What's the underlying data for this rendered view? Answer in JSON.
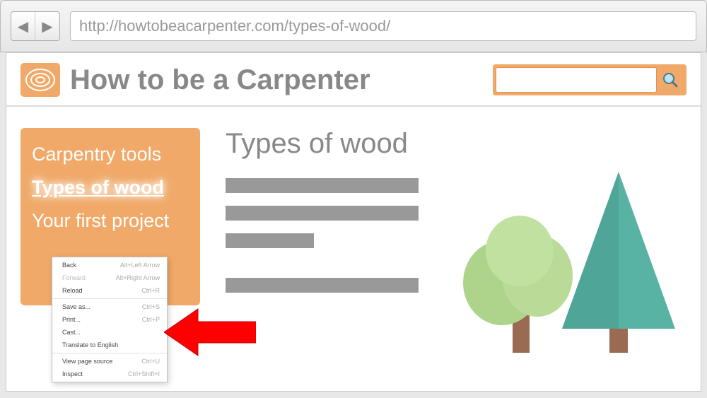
{
  "browser": {
    "url": "http://howtobeacarpenter.com/types-of-wood/"
  },
  "site": {
    "title": "How to be a Carpenter"
  },
  "sidebar": {
    "items": [
      {
        "label": "Carpentry tools",
        "active": false
      },
      {
        "label": "Types of wood",
        "active": true
      },
      {
        "label": "Your first project",
        "active": false
      }
    ]
  },
  "page": {
    "title": "Types of wood"
  },
  "context_menu": {
    "items": [
      {
        "label": "Back",
        "shortcut": "Alt+Left Arrow",
        "enabled": true
      },
      {
        "label": "Forward",
        "shortcut": "Alt+Right Arrow",
        "enabled": false
      },
      {
        "label": "Reload",
        "shortcut": "Ctrl+R",
        "enabled": true
      },
      {
        "sep": true
      },
      {
        "label": "Save as...",
        "shortcut": "Ctrl+S",
        "enabled": true
      },
      {
        "label": "Print...",
        "shortcut": "Ctrl+P",
        "enabled": true
      },
      {
        "label": "Cast...",
        "shortcut": "",
        "enabled": true
      },
      {
        "label": "Translate to English",
        "shortcut": "",
        "enabled": true
      },
      {
        "sep": true
      },
      {
        "label": "View page source",
        "shortcut": "Ctrl+U",
        "enabled": true
      },
      {
        "label": "Inspect",
        "shortcut": "Ctrl+Shift+I",
        "enabled": true
      }
    ]
  },
  "pointer_hint": "View page source"
}
